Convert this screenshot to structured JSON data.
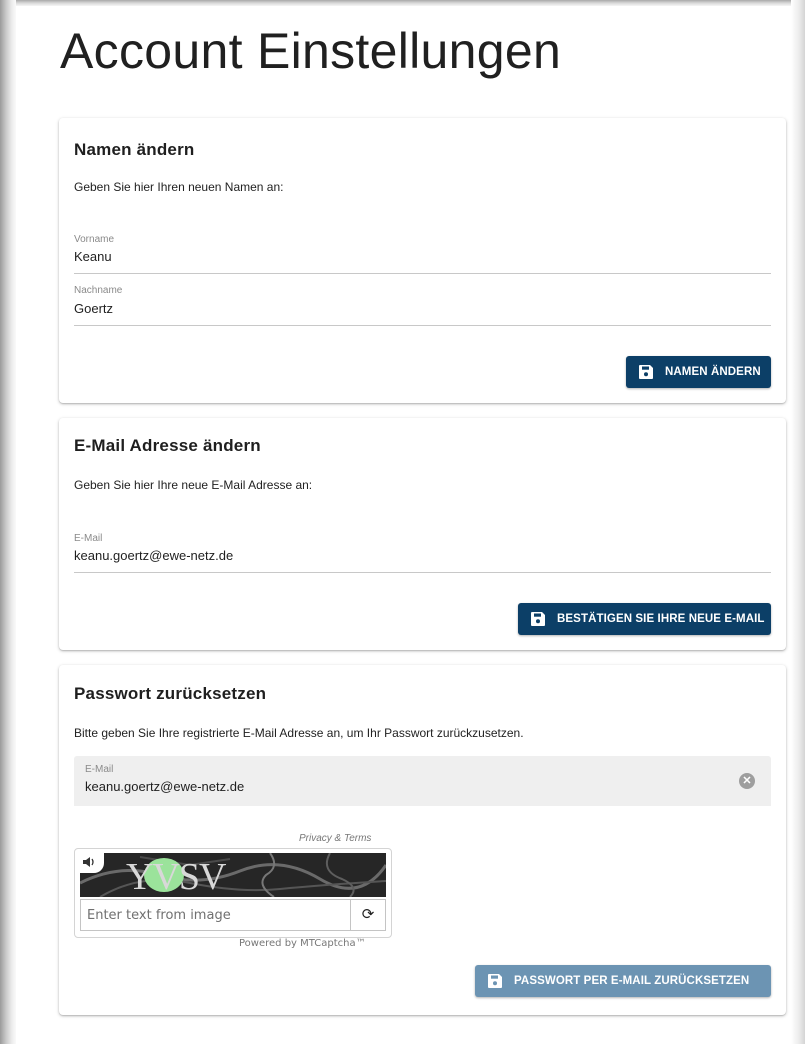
{
  "page": {
    "title": "Account Einstellungen"
  },
  "name_card": {
    "title": "Namen ändern",
    "description": "Geben Sie hier Ihren neuen Namen an:",
    "firstname": {
      "label": "Vorname",
      "value": "Keanu"
    },
    "lastname": {
      "label": "Nachname",
      "value": "Goertz"
    },
    "button": "NAMEN ÄNDERN"
  },
  "email_card": {
    "title": "E-Mail Adresse ändern",
    "description": "Geben Sie hier Ihre neue E-Mail Adresse an:",
    "email": {
      "label": "E-Mail",
      "value": "keanu.goertz@ewe-netz.de"
    },
    "button": "BESTÄTIGEN SIE IHRE NEUE E-MAIL"
  },
  "password_card": {
    "title": "Passwort zurücksetzen",
    "description": "Bitte geben Sie Ihre registrierte E-Mail Adresse an, um Ihr Passwort zurückzusetzen.",
    "email": {
      "label": "E-Mail",
      "value": "keanu.goertz@ewe-netz.de"
    },
    "captcha": {
      "privacy_link": "Privacy & Terms",
      "image_text": "YVSV",
      "input_placeholder": "Enter text from image",
      "powered_by": "Powered by MTCaptcha™"
    },
    "button": "PASSWORT PER E-MAIL ZURÜCKSETZEN"
  },
  "colors": {
    "primary_button": "#0c3f67",
    "disabled_button": "#6c94b3",
    "captcha_highlight": "#9be39b"
  },
  "icons": {
    "button_icon": "save-icon",
    "clear_icon": "clear-circle-icon",
    "audio_icon": "speaker-icon",
    "refresh_icon": "refresh-icon"
  }
}
